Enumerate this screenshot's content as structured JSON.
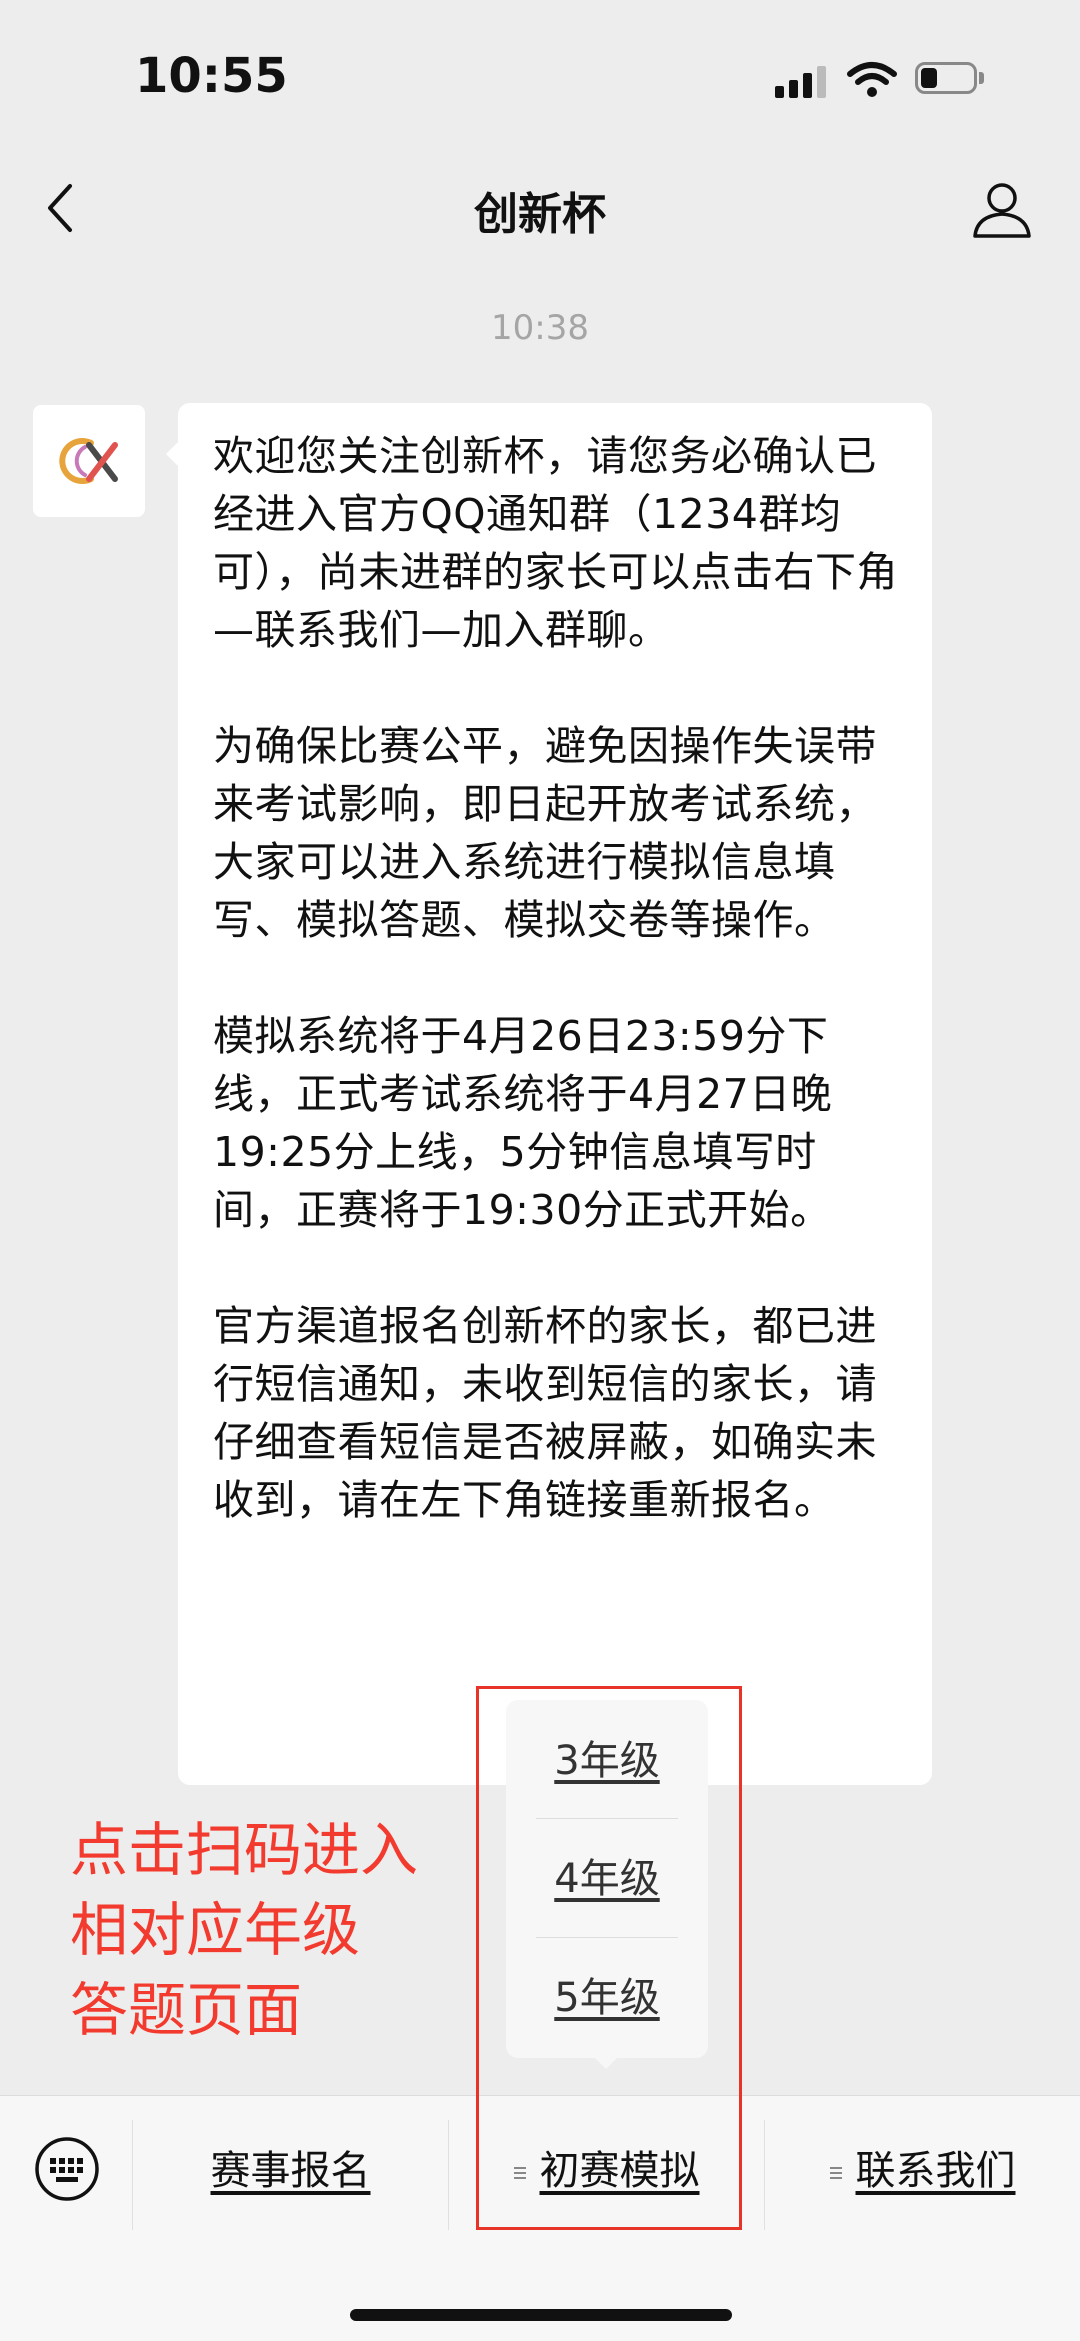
{
  "status_bar": {
    "time": "10:55"
  },
  "header": {
    "title": "创新杯"
  },
  "chat": {
    "timestamp": "10:38",
    "message_paragraphs": [
      "欢迎您关注创新杯，请您务必确认已经进入官方QQ通知群（1234群均可），尚未进群的家长可以点击右下角—联系我们—加入群聊。",
      "为确保比赛公平，避免因操作失误带来考试影响，即日起开放考试系统，大家可以进入系统进行模拟信息填写、模拟答题、模拟交卷等操作。",
      "模拟系统将于4月26日23:59分下线，正式考试系统将于4月27日晚19:25分上线，5分钟信息填写时间，正赛将于19:30分正式开始。",
      "官方渠道报名创新杯的家长，都已进行短信通知，未收到短信的家长，请仔细查看短信是否被屏蔽，如确实未收到，请在左下角链接重新报名。"
    ]
  },
  "annotation": {
    "text": "点击扫码进入\n相对应年级\n答题页面"
  },
  "popup_menu": {
    "items": [
      "3年级",
      "4年级",
      "5年级"
    ]
  },
  "bottom_menu": {
    "items": [
      "赛事报名",
      "初赛模拟",
      "联系我们"
    ]
  },
  "colors": {
    "annotation_red": "#f23b2e",
    "highlight_border": "#e83428",
    "background": "#ededed"
  },
  "icons": {
    "back": "chevron-left-icon",
    "profile": "person-icon",
    "keyboard": "keyboard-icon"
  }
}
